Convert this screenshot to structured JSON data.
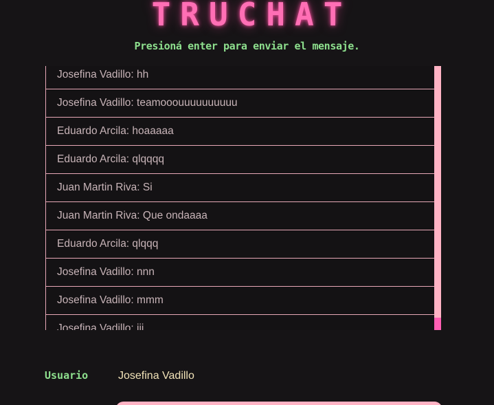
{
  "header": {
    "title": "TRUCHAT",
    "subtitle": "Presioná enter para enviar el mensaje."
  },
  "chat": {
    "messages": [
      {
        "text": "Josefina Vadillo: hh"
      },
      {
        "text": "Josefina Vadillo: teamooouuuuuuuuuu"
      },
      {
        "text": "Eduardo Arcila: hoaaaaa"
      },
      {
        "text": "Eduardo Arcila: qlqqqq"
      },
      {
        "text": "Juan Martin Riva: Si"
      },
      {
        "text": "Juan Martin Riva: Que ondaaaa"
      },
      {
        "text": "Eduardo Arcila: qlqqq"
      },
      {
        "text": "Josefina Vadillo: nnn"
      },
      {
        "text": "Josefina Vadillo: mmm"
      },
      {
        "text": "Josefina Vadillo: iii"
      }
    ],
    "scroll_position": 1.0
  },
  "user": {
    "label": "Usuario",
    "name": "Josefina Vadillo"
  },
  "colors": {
    "background": "#161416",
    "accent_pink": "#ff6fb5",
    "accent_green": "#8ee08e",
    "border_pink": "#e9a9b8",
    "scrollbar_track": "#ffb3c4",
    "scrollbar_thumb": "#ff5fb3",
    "message_text": "#c8b4b8",
    "username_text": "#f2e3b8"
  }
}
